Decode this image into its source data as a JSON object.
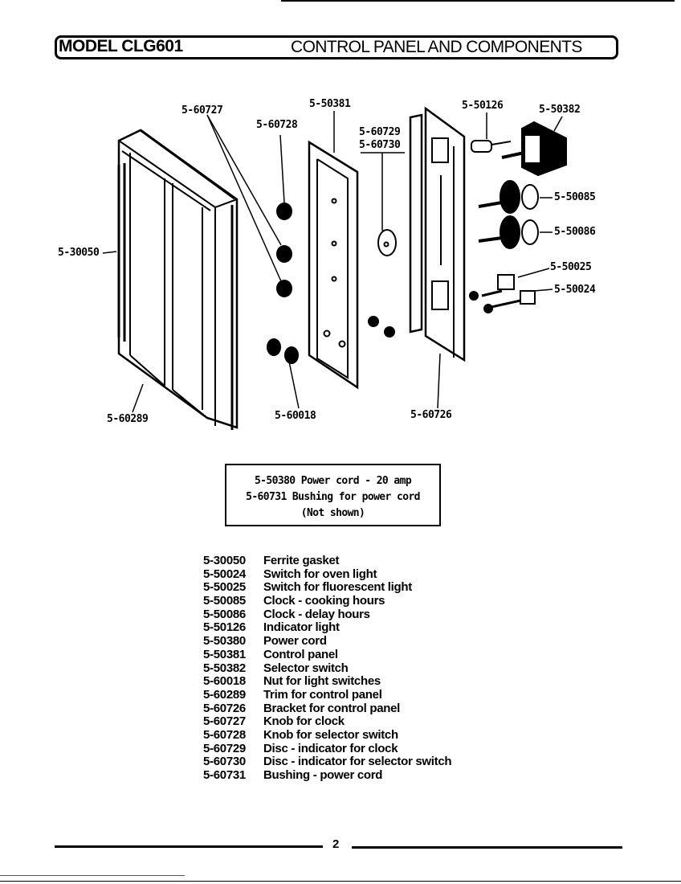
{
  "header": {
    "model": "MODEL CLG601",
    "section": "CONTROL PANEL AND COMPONENTS"
  },
  "callouts": {
    "c_60727": "5-60727",
    "c_60728": "5-60728",
    "c_50381": "5-50381",
    "c_60729": "5-60729",
    "c_60730": "5-60730",
    "c_50126": "5-50126",
    "c_50382": "5-50382",
    "c_50085": "5-50085",
    "c_50086": "5-50086",
    "c_50025": "5-50025",
    "c_50024": "5-50024",
    "c_30050": "5-30050",
    "c_60289": "5-60289",
    "c_60018": "5-60018",
    "c_60726": "5-60726"
  },
  "note": {
    "line1": "5-50380 Power cord - 20 amp",
    "line2": "5-60731 Bushing for power cord",
    "line3": "(Not shown)"
  },
  "parts": [
    {
      "number": "5-30050",
      "description": "Ferrite gasket"
    },
    {
      "number": "5-50024",
      "description": "Switch for oven light"
    },
    {
      "number": "5-50025",
      "description": "Switch for fluorescent light"
    },
    {
      "number": "5-50085",
      "description": "Clock - cooking hours"
    },
    {
      "number": "5-50086",
      "description": "Clock - delay hours"
    },
    {
      "number": "5-50126",
      "description": "Indicator light"
    },
    {
      "number": "5-50380",
      "description": "Power cord"
    },
    {
      "number": "5-50381",
      "description": "Control panel"
    },
    {
      "number": "5-50382",
      "description": "Selector switch"
    },
    {
      "number": "5-60018",
      "description": "Nut for light switches"
    },
    {
      "number": "5-60289",
      "description": "Trim for control panel"
    },
    {
      "number": "5-60726",
      "description": "Bracket for control panel"
    },
    {
      "number": "5-60727",
      "description": "Knob for clock"
    },
    {
      "number": "5-60728",
      "description": "Knob for selector switch"
    },
    {
      "number": "5-60729",
      "description": "Disc - indicator for clock"
    },
    {
      "number": "5-60730",
      "description": "Disc - indicator for selector switch"
    },
    {
      "number": "5-60731",
      "description": "Bushing - power cord"
    }
  ],
  "footer": {
    "page_number": "2"
  }
}
